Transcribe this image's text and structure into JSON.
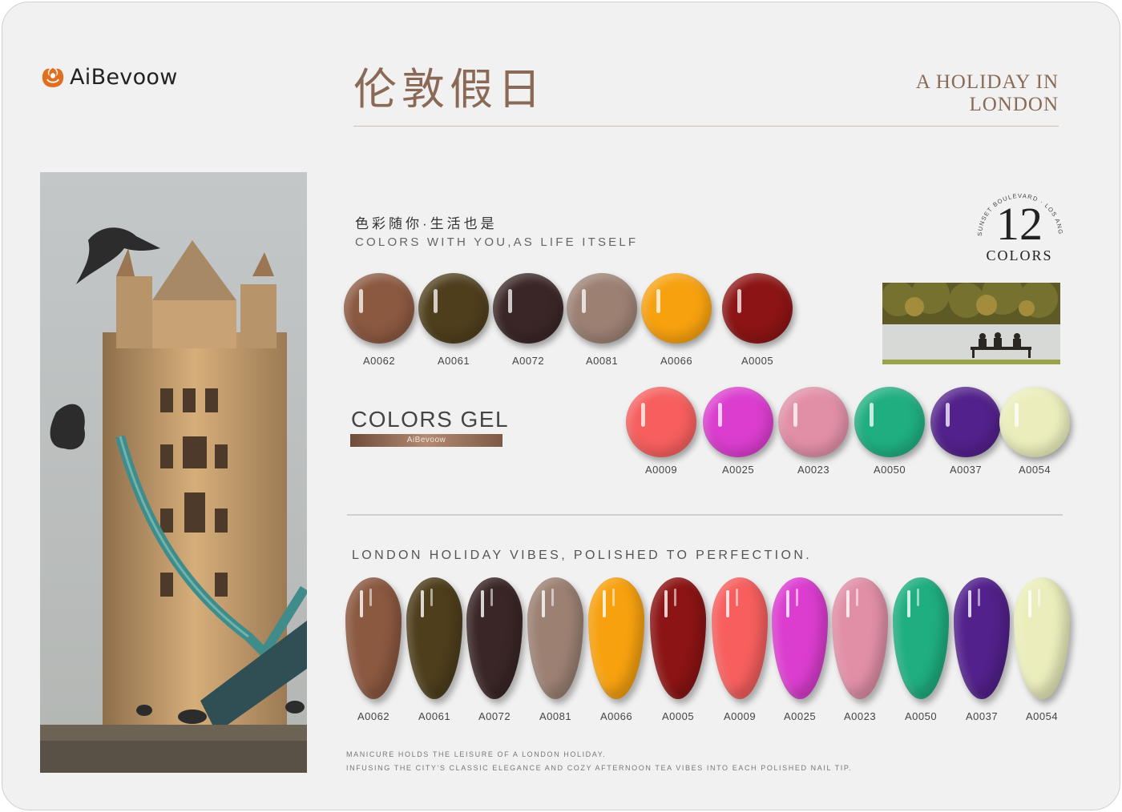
{
  "brand": {
    "name": "AiBevoow",
    "logo_icon": "rose-logo-icon",
    "accent_color": "#e0701f"
  },
  "header": {
    "title_cn": "伦敦假日",
    "title_en_line1": "A HOLIDAY IN",
    "title_en_line2": "LONDON",
    "title_color": "#8a6a57"
  },
  "slogan": {
    "cn": "色彩随你·生活也是",
    "en": "COLORS WITH YOU,AS LIFE ITSELF"
  },
  "badge": {
    "arc_text": "SUNSET BOULEVARD · LOS ANGELES",
    "number": "12",
    "label": "COLORS"
  },
  "gel": {
    "title": "COLORS GEL",
    "bar_text": "AiBevoow"
  },
  "swatches_row1": [
    {
      "code": "A0062",
      "color": "#8b5840"
    },
    {
      "code": "A0061",
      "color": "#4e3e1c"
    },
    {
      "code": "A0072",
      "color": "#3a2626"
    },
    {
      "code": "A0081",
      "color": "#9c8173"
    },
    {
      "code": "A0066",
      "color": "#f7a10f"
    },
    {
      "code": "A0005",
      "color": "#8c1414"
    }
  ],
  "swatches_row2": [
    {
      "code": "A0009",
      "color": "#f65f5e"
    },
    {
      "code": "A0025",
      "color": "#db3dcf"
    },
    {
      "code": "A0023",
      "color": "#e18fa7"
    },
    {
      "code": "A0050",
      "color": "#1fae7f"
    },
    {
      "code": "A0037",
      "color": "#52218b"
    },
    {
      "code": "A0054",
      "color": "#ebeebc"
    }
  ],
  "vibes_text": "LONDON HOLIDAY VIBES, POLISHED TO PERFECTION.",
  "nails": [
    {
      "code": "A0062",
      "color": "#8b5840"
    },
    {
      "code": "A0061",
      "color": "#4e3e1c"
    },
    {
      "code": "A0072",
      "color": "#3a2626"
    },
    {
      "code": "A0081",
      "color": "#9c8173"
    },
    {
      "code": "A0066",
      "color": "#f7a10f"
    },
    {
      "code": "A0005",
      "color": "#8c1414"
    },
    {
      "code": "A0009",
      "color": "#f65f5e"
    },
    {
      "code": "A0025",
      "color": "#db3dcf"
    },
    {
      "code": "A0023",
      "color": "#e18fa7"
    },
    {
      "code": "A0050",
      "color": "#1fae7f"
    },
    {
      "code": "A0037",
      "color": "#52218b"
    },
    {
      "code": "A0054",
      "color": "#ebeebc"
    }
  ],
  "footer": {
    "line1": "MANICURE HOLDS THE LEISURE OF A LONDON HOLIDAY.",
    "line2": "INFUSING THE CITY'S CLASSIC ELEGANCE AND COZY AFTERNOON TEA VIBES INTO EACH POLISHED NAIL TIP."
  }
}
